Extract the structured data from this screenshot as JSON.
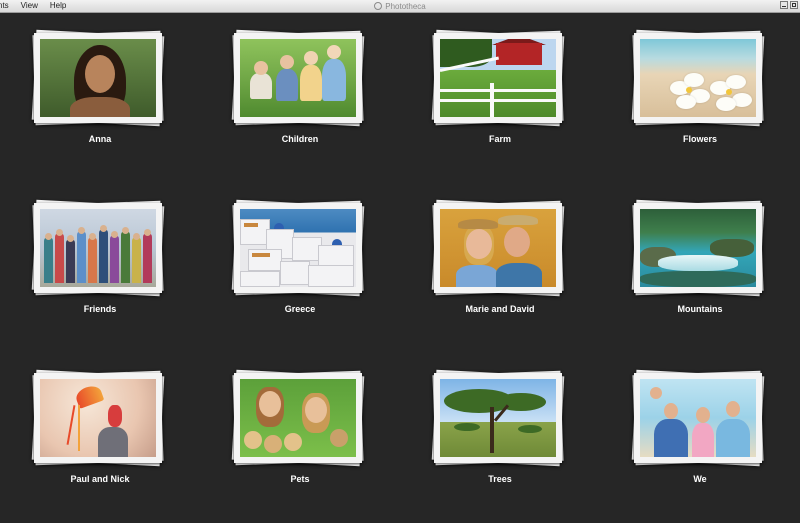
{
  "window": {
    "title": "Phototheca",
    "menu": [
      "nts",
      "View",
      "Help"
    ]
  },
  "albums": [
    {
      "label": "Anna"
    },
    {
      "label": "Children"
    },
    {
      "label": "Farm"
    },
    {
      "label": "Flowers"
    },
    {
      "label": "Friends"
    },
    {
      "label": "Greece"
    },
    {
      "label": "Marie and David"
    },
    {
      "label": "Mountains"
    },
    {
      "label": "Paul and Nick"
    },
    {
      "label": "Pets"
    },
    {
      "label": "Trees"
    },
    {
      "label": "We"
    }
  ],
  "colors": {
    "background": "#262626",
    "label": "#ffffff"
  }
}
